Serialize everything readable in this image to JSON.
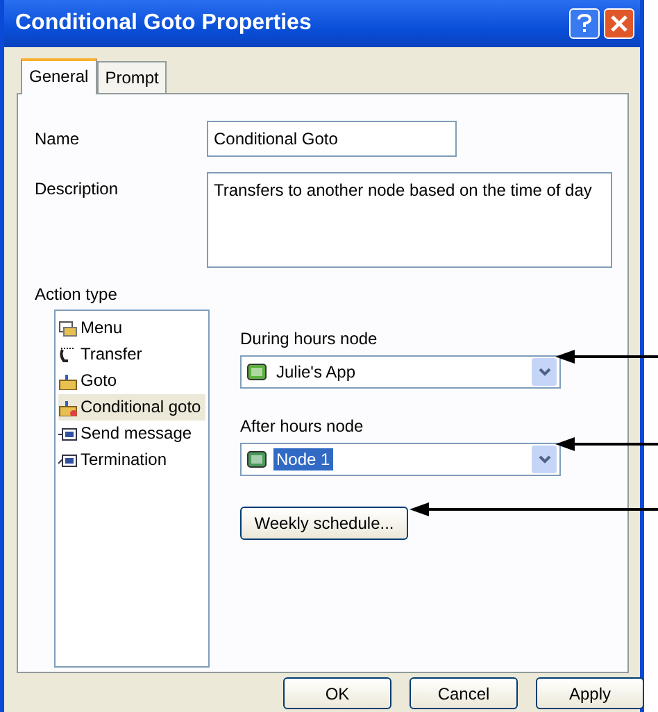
{
  "window": {
    "title": "Conditional Goto Properties"
  },
  "tabs": [
    {
      "label": "General",
      "selected": true
    },
    {
      "label": "Prompt",
      "selected": false
    }
  ],
  "name": {
    "label": "Name",
    "value": "Conditional Goto"
  },
  "description": {
    "label": "Description",
    "value": "Transfers to another node based on the time of day"
  },
  "action_type": {
    "label": "Action type",
    "items": [
      {
        "label": "Menu",
        "kind": "menu",
        "selected": false
      },
      {
        "label": "Transfer",
        "kind": "transfer",
        "selected": false
      },
      {
        "label": "Goto",
        "kind": "goto",
        "selected": false
      },
      {
        "label": "Conditional goto",
        "kind": "conditional",
        "selected": true
      },
      {
        "label": "Send message",
        "kind": "message",
        "selected": false
      },
      {
        "label": "Termination",
        "kind": "termination",
        "selected": false
      }
    ]
  },
  "during_hours_node": {
    "label": "During hours node",
    "value": "Julie's App",
    "focused": false
  },
  "after_hours_node": {
    "label": "After hours node",
    "value": "Node 1",
    "focused": true
  },
  "weekly_schedule_button": "Weekly schedule...",
  "buttons": [
    "OK",
    "Cancel",
    "Apply"
  ]
}
